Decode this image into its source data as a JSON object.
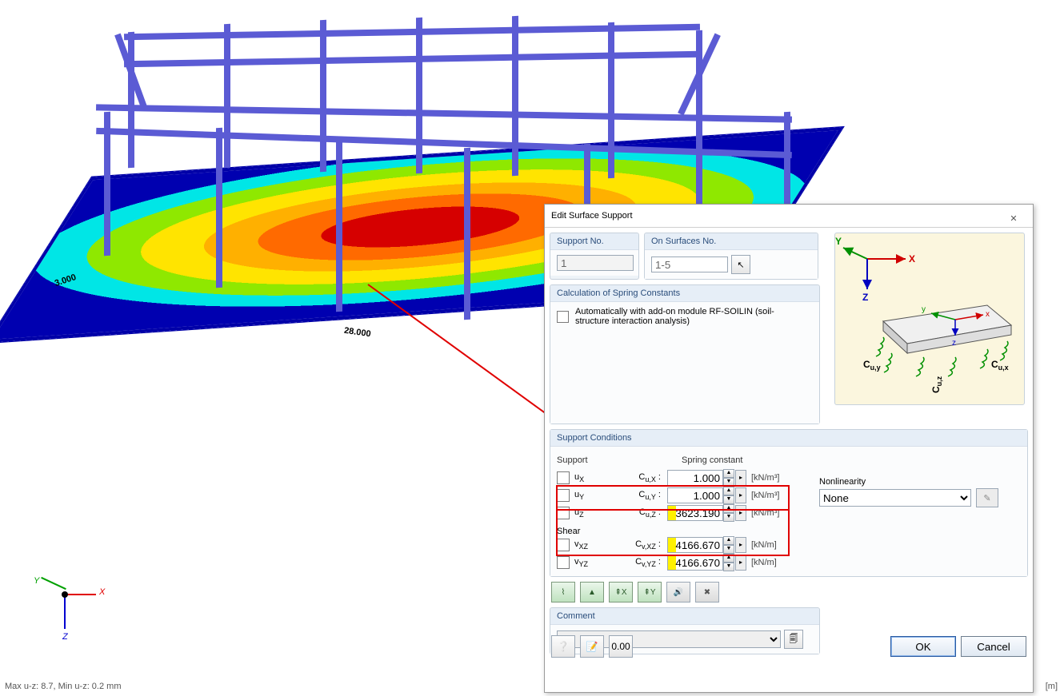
{
  "status_text": "Max u-z: 8.7, Min u-z: 0.2 mm",
  "unit_corner": "[m]",
  "dimensions": {
    "short": "3.000",
    "long": "28.000"
  },
  "axes": {
    "x": "X",
    "y": "Y",
    "z": "Z"
  },
  "dialog": {
    "title": "Edit Surface Support",
    "close": "✕",
    "support_no": {
      "label": "Support No.",
      "value": "1"
    },
    "on_surfaces": {
      "label": "On Surfaces No.",
      "value": "1-5",
      "pick_tooltip": "Pick"
    },
    "calc": {
      "label": "Calculation of Spring Constants",
      "auto_label": "Automatically with add-on module RF-SOILIN (soil-structure interaction analysis)"
    },
    "preview_labels": {
      "cux": "Cu,x",
      "cuy": "Cu,y",
      "cuz": "Cu,z",
      "x": "X",
      "y": "Y",
      "z": "Z",
      "lx": "x",
      "ly": "y",
      "lz": "z"
    },
    "support_conditions": {
      "label": "Support Conditions",
      "col_support": "Support",
      "col_spring": "Spring constant",
      "rows": {
        "ux": {
          "var": "uX",
          "sc_label": "Cu,X :",
          "value": "1.000",
          "unit": "[kN/m³]"
        },
        "uy": {
          "var": "uY",
          "sc_label": "Cu,Y :",
          "value": "1.000",
          "unit": "[kN/m³]"
        },
        "uz": {
          "var": "uZ",
          "sc_label": "Cu,Z :",
          "value": "3623.190",
          "unit": "[kN/m³]"
        }
      },
      "shear_label": "Shear",
      "shear": {
        "vxz": {
          "var": "vXZ",
          "sc_label": "Cv,XZ :",
          "value": "4166.670",
          "unit": "[kN/m]"
        },
        "vyz": {
          "var": "vYZ",
          "sc_label": "Cv,YZ :",
          "value": "4166.670",
          "unit": "[kN/m]"
        }
      },
      "nonlinearity_label": "Nonlinearity",
      "nonlinearity_value": "None"
    },
    "tools": {
      "t1": "⌇",
      "t2": "▲",
      "t3": "⇞X",
      "t4": "⇞Y",
      "t5": "🔊",
      "t6": "✖"
    },
    "comment": {
      "label": "Comment",
      "value": ""
    },
    "bottom_icons": {
      "help": "?",
      "edit": "✎",
      "units": "0.00"
    },
    "ok": "OK",
    "cancel": "Cancel"
  }
}
